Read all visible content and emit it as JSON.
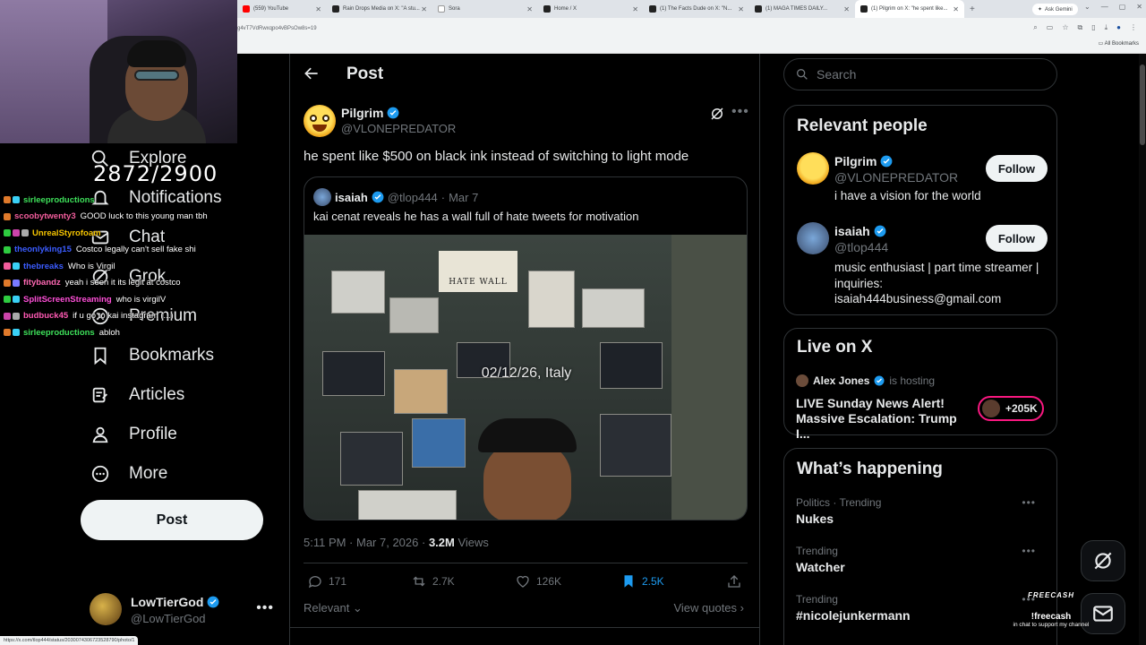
{
  "browser": {
    "tabs": [
      {
        "label": "(559) YouTube"
      },
      {
        "label": "Rain Drops Media on X: \"A stu..."
      },
      {
        "label": "Sora"
      },
      {
        "label": "Home / X"
      },
      {
        "label": "(1) The Facts Dude on X: \"N..."
      },
      {
        "label": "(1) MAGA TIMES DAILY..."
      },
      {
        "label": "(1) Pilgrim on X: \"he spent like..."
      }
    ],
    "ask_gemini": "Ask Gemini",
    "url": "g4vT7VdRwxqpo4vBPsOw8s=19",
    "all_bookmarks": "All Bookmarks",
    "status_url": "https://x.com/tlop444/status/2030074306723528790/photo/1"
  },
  "stream": {
    "sub_count": "2872/2900",
    "chat": [
      {
        "user": "sirleeproductions",
        "color": "#3ee05a",
        "msg": ""
      },
      {
        "user": "scoobytwenty3",
        "color": "#f25d9c",
        "msg": "GOOD luck to this young man tbh"
      },
      {
        "user": "UnrealStyrofoam",
        "color": "#f5c400",
        "msg": ""
      },
      {
        "user": "theonlyking15",
        "color": "#3b5cff",
        "msg": "Costco legally can't sell fake shi"
      },
      {
        "user": "thebreaks",
        "color": "#3b5cff",
        "msg": "Who is Virgil"
      },
      {
        "user": "fitybandz",
        "color": "#ff69b4",
        "msg": "yeah i seen it its legit at costco"
      },
      {
        "user": "SplitScreenStreaming",
        "color": "#ff4fd8",
        "msg": "who is virgilV"
      },
      {
        "user": "budbuck45",
        "color": "#ff5ab4",
        "msg": "if u go to kai instagram (...)"
      },
      {
        "user": "sirleeproductions",
        "color": "#3ee05a",
        "msg": "abloh"
      }
    ]
  },
  "nav": {
    "items": [
      {
        "label": "Explore",
        "icon": "search-icon"
      },
      {
        "label": "Notifications",
        "icon": "bell-icon"
      },
      {
        "label": "Chat",
        "icon": "mail-icon"
      },
      {
        "label": "Grok",
        "icon": "grok-icon"
      },
      {
        "label": "Premium",
        "icon": "x-icon"
      },
      {
        "label": "Bookmarks",
        "icon": "bookmark-icon"
      },
      {
        "label": "Articles",
        "icon": "article-icon"
      },
      {
        "label": "Profile",
        "icon": "person-icon"
      },
      {
        "label": "More",
        "icon": "more-circle-icon"
      }
    ],
    "post_button": "Post",
    "account": {
      "name": "LowTierGod",
      "handle": "@LowTierGod"
    }
  },
  "main": {
    "header_title": "Post",
    "tweet": {
      "author_name": "Pilgrim",
      "author_handle": "@VLONEPREDATOR",
      "text": "he spent like $500 on black ink instead of switching to light mode",
      "quote": {
        "name": "isaiah",
        "handle": "@tlop444",
        "date": "Mar 7",
        "text": "kai cenat reveals he has a wall full of hate tweets for motivation",
        "video_overlay": "02/12/26, Italy",
        "sign_text": "HATE WALL"
      },
      "time": "5:11 PM · Mar 7, 2026 · ",
      "views_count": "3.2M",
      "views_label": "Views",
      "replies": "171",
      "reposts": "2.7K",
      "likes": "126K",
      "bookmarks": "2.5K",
      "relevant_label": "Relevant",
      "view_quotes": "View quotes"
    }
  },
  "right": {
    "search_placeholder": "Search",
    "relevant_people": {
      "title": "Relevant people",
      "people": [
        {
          "name": "Pilgrim",
          "handle": "@VLONEPREDATOR",
          "bio": "i have a vision for the world",
          "follow": "Follow"
        },
        {
          "name": "isaiah",
          "handle": "@tlop444",
          "bio": "music enthusiast | part time streamer | inquiries: isaiah444business@gmail.com",
          "follow": "Follow"
        }
      ]
    },
    "live": {
      "title": "Live on X",
      "host_name": "Alex Jones",
      "host_suffix": "is hosting",
      "stream_title": "LIVE Sunday News Alert! Massive Escalation: Trump I...",
      "listeners": "+205K"
    },
    "happening": {
      "title": "What’s happening",
      "trends": [
        {
          "meta": "Politics · Trending",
          "name": "Nukes"
        },
        {
          "meta": "Trending",
          "name": "Watcher"
        },
        {
          "meta": "Trending",
          "name": "#nicolejunkermann"
        }
      ]
    }
  },
  "freecash": {
    "brand": "FREECASH",
    "command": "!freecash",
    "sub": "in chat to support my channel"
  },
  "colors": {
    "verified": "#1d9bf0",
    "accent": "#1d9bf0",
    "live": "#f91880"
  }
}
